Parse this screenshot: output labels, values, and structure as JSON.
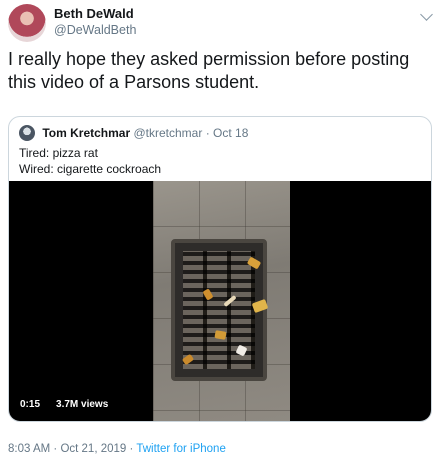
{
  "author": {
    "display_name": "Beth DeWald",
    "handle": "@DeWaldBeth"
  },
  "tweet": {
    "text": "I really hope they asked permission before posting this video of a Parsons student."
  },
  "quoted_tweet": {
    "display_name": "Tom Kretchmar",
    "handle": "@tkretchmar",
    "separator": "·",
    "date": "Oct 18",
    "lines": [
      "Tired: pizza rat",
      "Wired: cigarette cockroach"
    ],
    "video": {
      "duration": "0:15",
      "views": "3.7M views"
    }
  },
  "footer": {
    "time": "8:03 AM",
    "separator": "·",
    "date": "Oct 21, 2019",
    "source": "Twitter for iPhone"
  },
  "icons": {
    "avatar": "user-avatar",
    "menu": "chevron-down-icon"
  }
}
